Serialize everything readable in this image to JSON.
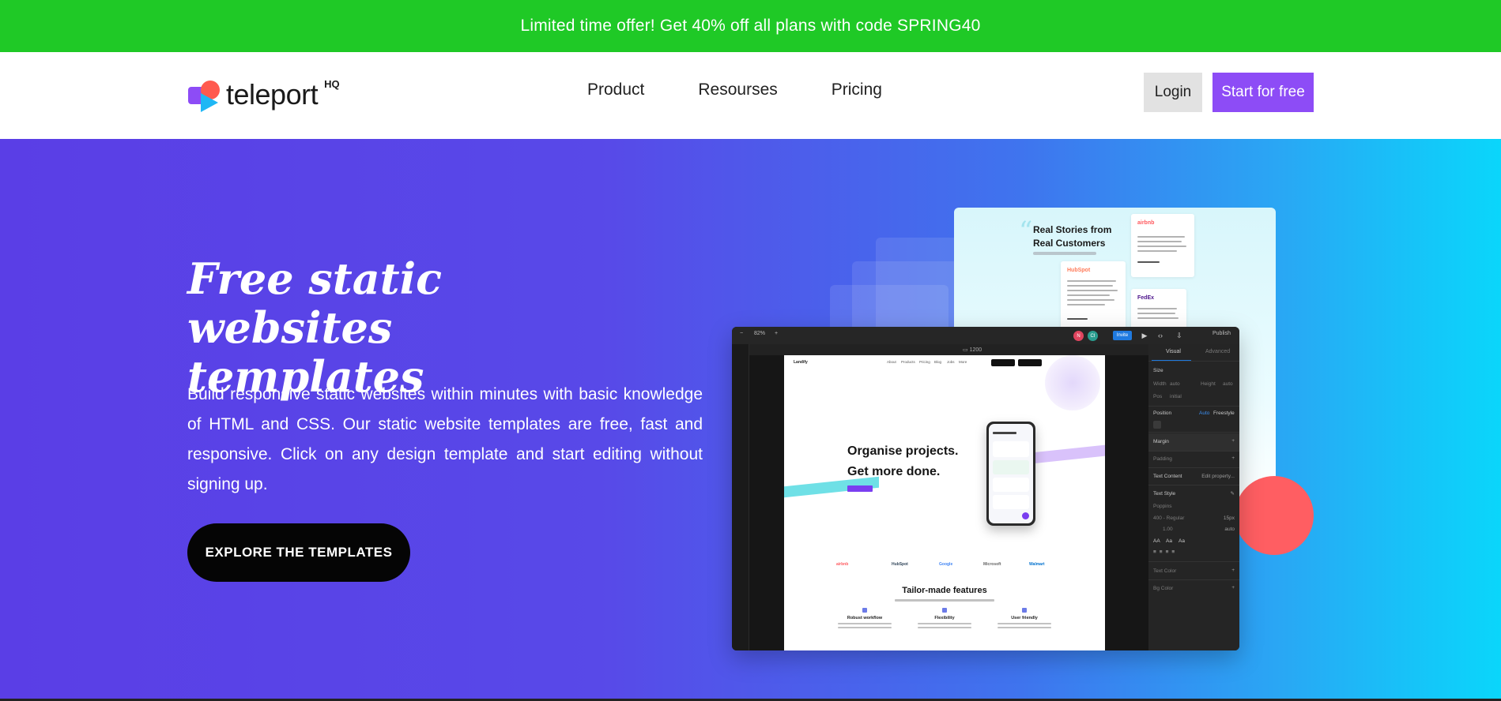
{
  "promo": {
    "text": "Limited time offer! Get 40% off all plans with code SPRING40",
    "color": "#1fc926"
  },
  "header": {
    "logo_text": "teleport",
    "logo_suffix": "HQ",
    "nav": [
      {
        "label": "Product"
      },
      {
        "label": "Resourses"
      },
      {
        "label": "Pricing"
      }
    ],
    "login_label": "Login",
    "start_label": "Start for free",
    "accent": "#8d4cf6"
  },
  "hero": {
    "title": "Free static websites templates",
    "description": "Build responsive static websites within minutes with basic knowledge of HTML and CSS. Our static website templates are free, fast and responsive. Click on any design template and start editing without signing up.",
    "cta_label": "EXPLORE THE TEMPLATES",
    "gradient_start": "#5a3ee6",
    "gradient_end": "#0ad6fb"
  },
  "testimonials_preview": {
    "title_line1": "Real Stories from",
    "title_line2": "Real Customers",
    "brands": [
      "airbnb",
      "HubSpot",
      "FedEx"
    ]
  },
  "editor_preview": {
    "zoom": "82%",
    "avatars": [
      "N",
      "CI"
    ],
    "share_label": "Invite",
    "publish_label": "Publish",
    "breakpoint": "1200",
    "page": {
      "logo": "Landify",
      "nav": [
        "About",
        "Products",
        "Pricing",
        "Blog",
        "Jobs",
        "More"
      ],
      "heading_line1": "Organise projects.",
      "heading_line2": "Get more done.",
      "brands": [
        "airbnb",
        "HubSpot",
        "Google",
        "Microsoft",
        "Walmart"
      ],
      "features_title": "Tailor-made features",
      "features": [
        "Robust workflow",
        "Flexibility",
        "User friendly"
      ]
    },
    "panel": {
      "tabs": [
        "Visual",
        "Advanced"
      ],
      "size_label": "Size",
      "width_label": "Width",
      "width_value": "auto",
      "height_label": "Height",
      "height_value": "auto",
      "pos_label": "Pos",
      "pos_value": "initial",
      "position_label": "Position",
      "position_auto": "Auto",
      "position_freestyle": "Freestyle",
      "margin_label": "Margin",
      "padding_label": "Padding",
      "text_content_label": "Text Content",
      "text_content_value": "Edit property...",
      "text_style_label": "Text Style",
      "font_family": "Poppins",
      "font_weight": "400 - Regular",
      "font_size": "15px",
      "line_height": "1.00",
      "letter_spacing": "auto",
      "case_options": [
        "AA",
        "Aa",
        "Aa"
      ],
      "text_color_label": "Text Color",
      "bg_color_label": "Bg Color"
    }
  }
}
